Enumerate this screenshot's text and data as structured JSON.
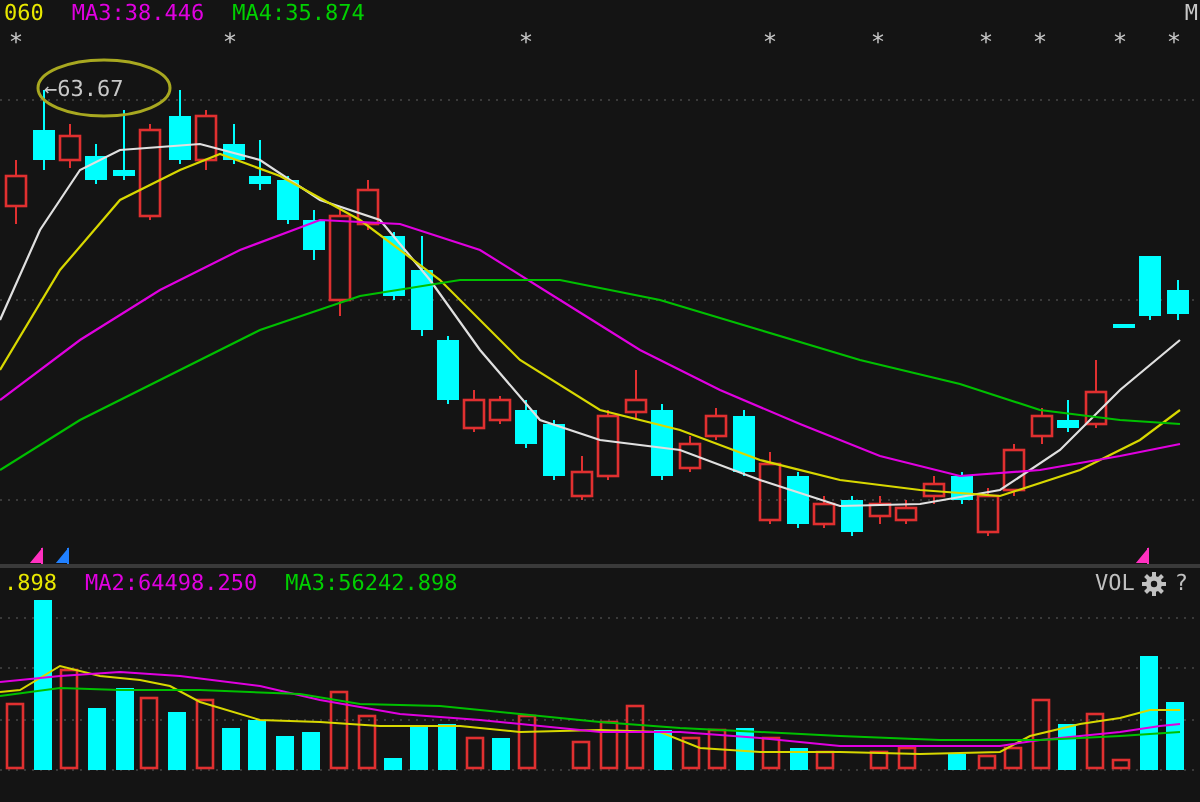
{
  "price_panel": {
    "legends": [
      {
        "label": "060",
        "color": "#e8e800"
      },
      {
        "label": "MA3:38.446",
        "color": "#e000e0"
      },
      {
        "label": "MA4:35.874",
        "color": "#00d000"
      }
    ],
    "corner_label": "M",
    "markers": [
      "*",
      "*",
      "*",
      "*",
      "*",
      "*",
      "*",
      "*",
      "*"
    ],
    "peak_label": "←63.67"
  },
  "volume_panel": {
    "legends": [
      {
        "label": ".898",
        "color": "#e8e800"
      },
      {
        "label": "MA2:64498.250",
        "color": "#e000e0"
      },
      {
        "label": "MA3:56242.898",
        "color": "#00d000"
      }
    ],
    "indicator": "VOL",
    "help": "?"
  }
}
